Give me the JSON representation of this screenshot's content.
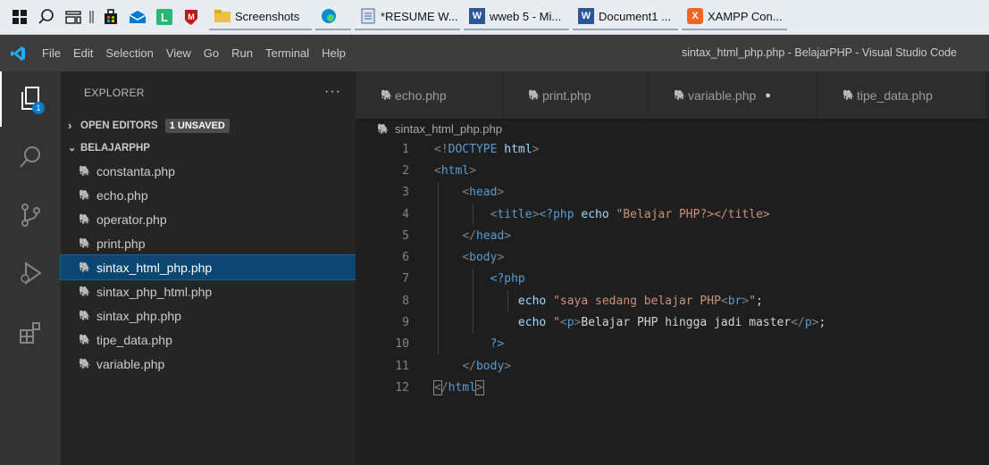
{
  "taskbar": {
    "items": [
      {
        "label": "Screenshots",
        "icon": "folder-icon"
      },
      {
        "label": "",
        "icon": "edge-icon"
      },
      {
        "label": "*RESUME W...",
        "icon": "notepad-icon"
      },
      {
        "label": "wweb 5 - Mi...",
        "icon": "word-icon"
      },
      {
        "label": "Document1 ...",
        "icon": "word-icon"
      },
      {
        "label": "XAMPP Con...",
        "icon": "xampp-icon"
      }
    ]
  },
  "titlebar": {
    "menu": [
      "File",
      "Edit",
      "Selection",
      "View",
      "Go",
      "Run",
      "Terminal",
      "Help"
    ],
    "window_title": "sintax_html_php.php - BelajarPHP - Visual Studio Code"
  },
  "activity": {
    "explorer_badge": "1"
  },
  "sidebar": {
    "header": "EXPLORER",
    "more": "···",
    "open_editors": "OPEN EDITORS",
    "unsaved_badge": "1 UNSAVED",
    "folder": "BELAJARPHP",
    "files": [
      "constanta.php",
      "echo.php",
      "operator.php",
      "print.php",
      "sintax_html_php.php",
      "sintax_php_html.php",
      "sintax_php.php",
      "tipe_data.php",
      "variable.php"
    ],
    "active_file": "sintax_html_php.php"
  },
  "editor": {
    "tabs": [
      "echo.php",
      "print.php",
      "variable.php",
      "tipe_data.php"
    ],
    "breadcrumb": "sintax_html_php.php",
    "line_numbers": [
      "1",
      "2",
      "3",
      "4",
      "5",
      "6",
      "7",
      "8",
      "9",
      "10",
      "11",
      "12"
    ]
  },
  "colors": {
    "accent": "#007acc",
    "php_icon": "#a074c4",
    "selection": "#094771"
  }
}
